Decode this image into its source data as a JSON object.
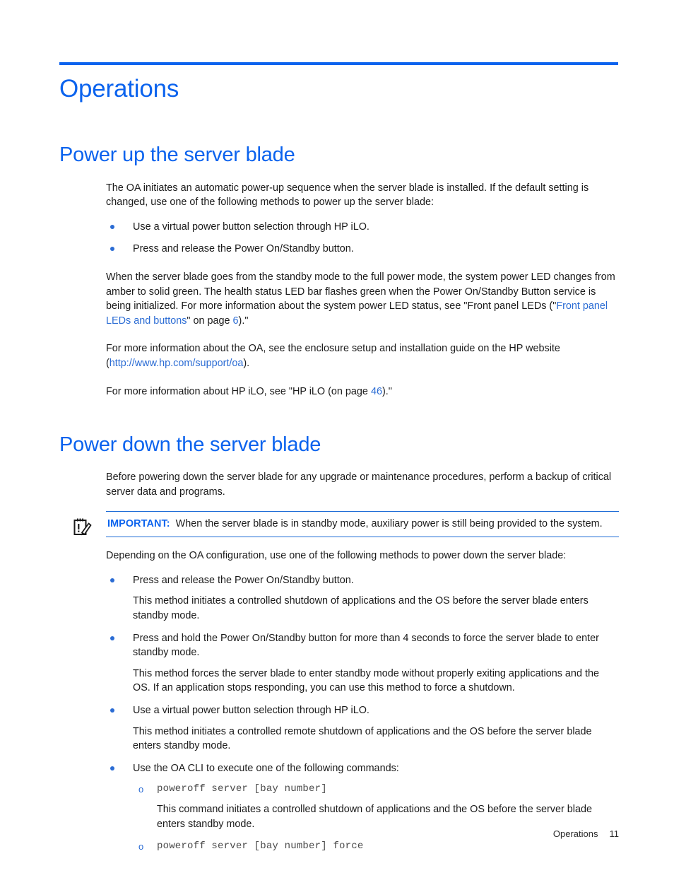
{
  "chapter": {
    "title": "Operations"
  },
  "sections": [
    {
      "heading": "Power up the server blade",
      "intro": "The OA initiates an automatic power-up sequence when the server blade is installed. If the default setting is changed, use one of the following methods to power up the server blade:",
      "bullets": [
        "Use a virtual power button selection through HP iLO.",
        "Press and release the Power On/Standby button."
      ],
      "para_led_a": "When the server blade goes from the standby mode to the full power mode, the system power LED changes from amber to solid green. The health status LED bar flashes green when the Power On/Standby Button service is being initialized. For more information about the system power LED status, see \"Front panel LEDs (\"",
      "para_led_link": "Front panel LEDs and buttons",
      "para_led_b": "\" on page ",
      "para_led_page": "6",
      "para_led_c": ").\"",
      "para_oa_a": "For more information about the OA, see the enclosure setup and installation guide on the HP website (",
      "para_oa_link": "http://www.hp.com/support/oa",
      "para_oa_b": ").",
      "para_ilo_a": "For more information about HP iLO, see \"HP iLO (on page ",
      "para_ilo_page": "46",
      "para_ilo_b": ").\""
    }
  ],
  "section_down": {
    "heading": "Power down the server blade",
    "intro": "Before powering down the server blade for any upgrade or maintenance procedures, perform a backup of critical server data and programs.",
    "callout": {
      "icon": "important-notepad-icon",
      "label": "IMPORTANT:",
      "text": "When the server blade is in standby mode, auxiliary power is still being provided to the system."
    },
    "lead": "Depending on the OA configuration, use one of the following methods to power down the server blade:",
    "items": [
      {
        "bullet": "Press and release the Power On/Standby button.",
        "detail": "This method initiates a controlled shutdown of applications and the OS before the server blade enters standby mode."
      },
      {
        "bullet": "Press and hold the Power On/Standby button for more than 4 seconds to force the server blade to enter standby mode.",
        "detail": "This method forces the server blade to enter standby mode without properly exiting applications and the OS. If an application stops responding, you can use this method to force a shutdown."
      },
      {
        "bullet": "Use a virtual power button selection through HP iLO.",
        "detail": "This method initiates a controlled remote shutdown of applications and the OS before the server blade enters standby mode."
      },
      {
        "bullet": "Use the OA CLI to execute one of the following commands:",
        "detail": ""
      }
    ],
    "cli": [
      {
        "marker": "o",
        "command": "poweroff server [bay number]",
        "detail": "This command initiates a controlled shutdown of applications and the OS before the server blade enters standby mode."
      },
      {
        "marker": "o",
        "command": "poweroff server [bay number] force",
        "detail": ""
      }
    ]
  },
  "footer": {
    "label": "Operations",
    "page": "11"
  },
  "colors": {
    "heading_blue": "#0b63ee",
    "link_blue": "#2b6cd4",
    "rule_blue": "#0b63ee",
    "body_text": "#1a1a1a",
    "mono_text": "#4a4a4a"
  }
}
